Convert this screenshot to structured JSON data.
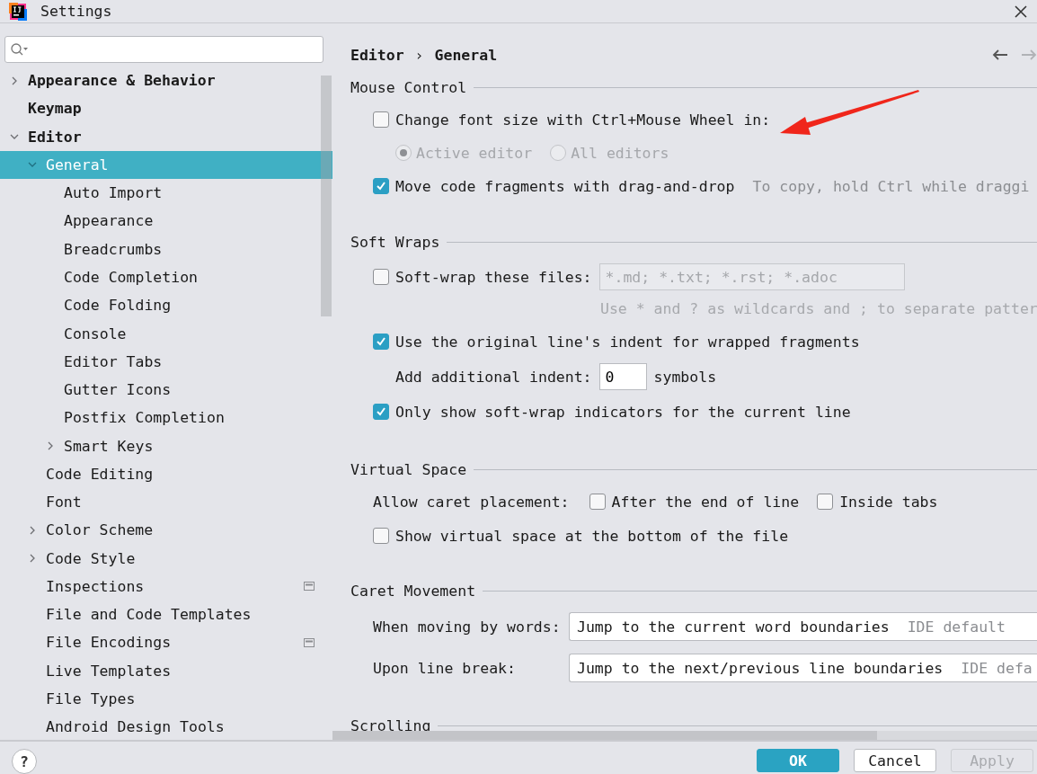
{
  "window": {
    "title": "Settings"
  },
  "sidebar": {
    "items": [
      {
        "label": "Appearance & Behavior",
        "expanded": false,
        "selected": false,
        "badge": false
      },
      {
        "label": "Keymap",
        "selected": false,
        "badge": false
      },
      {
        "label": "Editor",
        "expanded": true,
        "selected": false,
        "badge": false,
        "children": [
          {
            "label": "General",
            "expanded": true,
            "selected": true,
            "badge": false,
            "children": [
              {
                "label": "Auto Import",
                "selected": false,
                "badge": false
              },
              {
                "label": "Appearance",
                "selected": false,
                "badge": false
              },
              {
                "label": "Breadcrumbs",
                "selected": false,
                "badge": false
              },
              {
                "label": "Code Completion",
                "selected": false,
                "badge": false
              },
              {
                "label": "Code Folding",
                "selected": false,
                "badge": false
              },
              {
                "label": "Console",
                "selected": false,
                "badge": false
              },
              {
                "label": "Editor Tabs",
                "selected": false,
                "badge": false
              },
              {
                "label": "Gutter Icons",
                "selected": false,
                "badge": false
              },
              {
                "label": "Postfix Completion",
                "selected": false,
                "badge": false
              },
              {
                "label": "Smart Keys",
                "expanded": false,
                "selected": false,
                "badge": false
              }
            ]
          },
          {
            "label": "Code Editing",
            "selected": false,
            "badge": false
          },
          {
            "label": "Font",
            "selected": false,
            "badge": false
          },
          {
            "label": "Color Scheme",
            "expanded": false,
            "selected": false,
            "badge": false
          },
          {
            "label": "Code Style",
            "expanded": false,
            "selected": false,
            "badge": false
          },
          {
            "label": "Inspections",
            "selected": false,
            "badge": true
          },
          {
            "label": "File and Code Templates",
            "selected": false,
            "badge": false
          },
          {
            "label": "File Encodings",
            "selected": false,
            "badge": true
          },
          {
            "label": "Live Templates",
            "selected": false,
            "badge": false
          },
          {
            "label": "File Types",
            "selected": false,
            "badge": false
          },
          {
            "label": "Android Design Tools",
            "selected": false,
            "badge": false
          }
        ]
      }
    ]
  },
  "breadcrumb": {
    "items": [
      "Editor",
      "General"
    ],
    "separator": "›"
  },
  "nav": {
    "back": {
      "disabled": false
    },
    "forward": {
      "disabled": true
    }
  },
  "sections": [
    {
      "title": "Mouse Control",
      "rows": [
        {
          "kind": "checkbox",
          "label": "Change font size with Ctrl+Mouse Wheel in:",
          "checked": false
        },
        {
          "kind": "radios",
          "disabled": true,
          "options": [
            {
              "label": "Active editor",
              "selected": true
            },
            {
              "label": "All editors",
              "selected": false
            }
          ]
        },
        {
          "kind": "checkbox",
          "label": "Move code fragments with drag-and-drop",
          "checked": true,
          "hint": "To copy, hold Ctrl while draggi"
        }
      ]
    },
    {
      "title": "Soft Wraps",
      "rows": [
        {
          "kind": "checkfield",
          "label": "Soft-wrap these files:",
          "checked": false,
          "value": "*.md; *.txt; *.rst; *.adoc",
          "disabled": true
        },
        {
          "kind": "note",
          "text": "Use * and ? as wildcards and ; to separate patter"
        },
        {
          "kind": "checkbox",
          "label": "Use the original line's indent for wrapped fragments",
          "checked": true
        },
        {
          "kind": "number",
          "label": "Add additional indent:",
          "value": "0",
          "unit": "symbols"
        },
        {
          "kind": "checkbox",
          "label": "Only show soft-wrap indicators for the current line",
          "checked": true
        }
      ]
    },
    {
      "title": "Virtual Space",
      "rows": [
        {
          "kind": "checks",
          "label": "Allow caret placement:",
          "options": [
            {
              "label": "After the end of line",
              "checked": false
            },
            {
              "label": "Inside tabs",
              "checked": false
            }
          ]
        },
        {
          "kind": "checkbox",
          "label": "Show virtual space at the bottom of the file",
          "checked": false
        }
      ]
    },
    {
      "title": "Caret Movement",
      "rows": [
        {
          "kind": "combo",
          "label": "When moving by words:",
          "value": "Jump to the current word boundaries",
          "note": "IDE default"
        },
        {
          "kind": "combo",
          "label": "Upon line break:",
          "value": "Jump to the next/previous line boundaries",
          "note": "IDE defa"
        }
      ]
    },
    {
      "title": "Scrolling"
    }
  ],
  "help": "?",
  "buttons": [
    {
      "label": "OK",
      "kind": "primary"
    },
    {
      "label": "Cancel",
      "kind": "normal"
    },
    {
      "label": "Apply",
      "kind": "disabled"
    }
  ]
}
